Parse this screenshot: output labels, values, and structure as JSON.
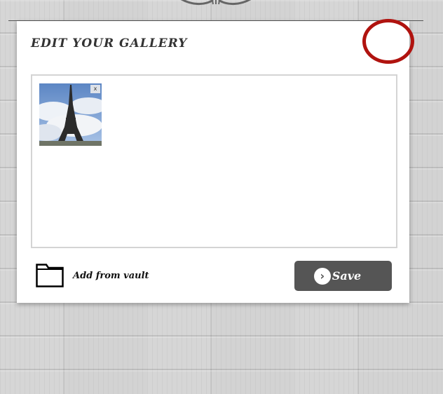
{
  "modal": {
    "title": "EDIT YOUR GALLERY",
    "close_color": "#b0130f"
  },
  "gallery": {
    "photos": [
      {
        "subject": "Eiffel Tower",
        "remove_label": "x"
      }
    ]
  },
  "footer": {
    "vault_label": "Add from vault",
    "vault_icon": "folder-icon",
    "save_label": "Save",
    "save_icon": "arrow-right-circle-icon",
    "save_color": "#555555"
  }
}
